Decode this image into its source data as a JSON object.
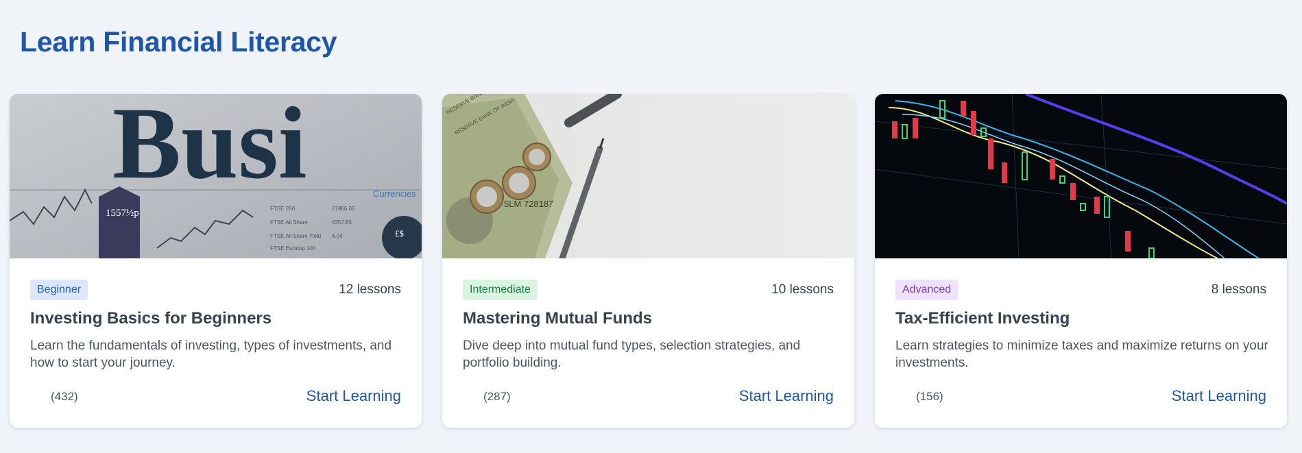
{
  "page": {
    "title": "Learn Financial Literacy"
  },
  "colors": {
    "title": "#1f56a8",
    "background": "#f0f3f8"
  },
  "cards": [
    {
      "image_icon": "newspaper-business-image",
      "level": "Beginner",
      "lessons": "12 lessons",
      "title": "Investing Basics for Beginners",
      "description": "Learn the fundamentals of investing, types of investments, and how to start your journey.",
      "rating_count": "(432)",
      "cta": "Start Learning",
      "image_text": "Busi"
    },
    {
      "image_icon": "currency-coins-pen-image",
      "level": "Intermediate",
      "lessons": "10 lessons",
      "title": "Mastering Mutual Funds",
      "description": "Dive deep into mutual fund types, selection strategies, and portfolio building.",
      "rating_count": "(287)",
      "cta": "Start Learning"
    },
    {
      "image_icon": "candlestick-chart-image",
      "level": "Advanced",
      "lessons": "8 lessons",
      "title": "Tax-Efficient Investing",
      "description": "Learn strategies to minimize taxes and maximize returns on your investments.",
      "rating_count": "(156)",
      "cta": "Start Learning"
    }
  ]
}
